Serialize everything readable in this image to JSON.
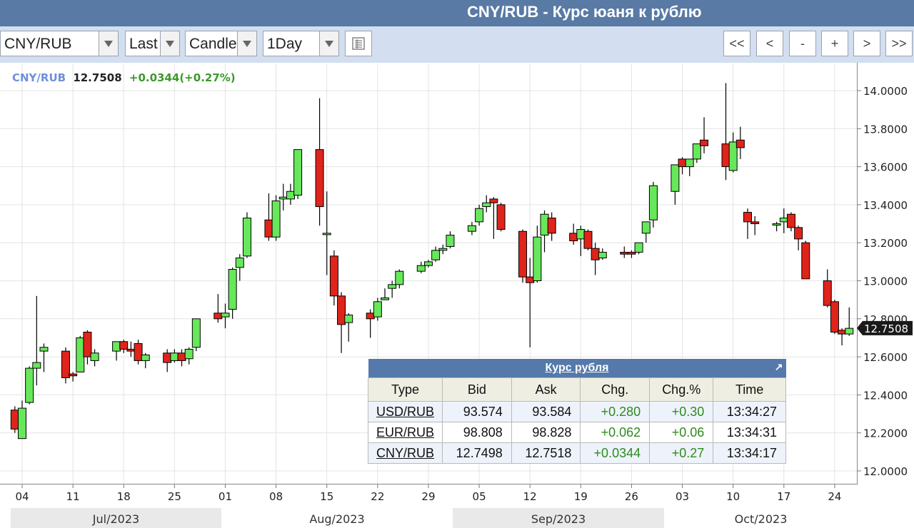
{
  "page_title": "CNY/RUB - Курс юаня к рублю",
  "toolbar": {
    "symbol": "CNY/RUB",
    "price_type": "Last",
    "chart_style": "Candle",
    "interval": "1Day",
    "nav": [
      "<<",
      "<",
      "-",
      "+",
      ">",
      ">>"
    ]
  },
  "quote": {
    "symbol": "CNY/RUB",
    "last": "12.7508",
    "change": "+0.0344(+0.27%)"
  },
  "chart_data": {
    "type": "candlestick",
    "title": "",
    "y_ticks": [
      "14.0000",
      "13.8000",
      "13.6000",
      "13.4000",
      "13.2000",
      "13.0000",
      "12.8000",
      "12.6000",
      "12.4000",
      "12.2000",
      "12.0000"
    ],
    "ylim": [
      11.96,
      14.15
    ],
    "x_ticks": [
      "04",
      "11",
      "18",
      "25",
      "01",
      "08",
      "15",
      "22",
      "29",
      "05",
      "12",
      "19",
      "26",
      "03",
      "10",
      "17",
      "24"
    ],
    "months": [
      "Jul/2023",
      "Aug/2023",
      "Sep/2023",
      "Oct/2023"
    ],
    "last_price_label": "12.7508",
    "colors": {
      "up": "#66e85a",
      "down": "#e0241b",
      "outline": "#000000"
    },
    "candles": [
      {
        "date": "2023-06-30",
        "o": 12.34,
        "h": 12.38,
        "l": 12.03,
        "c": 12.05
      },
      {
        "date": "2023-07-03",
        "o": 12.32,
        "h": 12.34,
        "l": 12.2,
        "c": 12.22
      },
      {
        "date": "2023-07-04",
        "o": 12.17,
        "h": 12.37,
        "l": 12.17,
        "c": 12.33
      },
      {
        "date": "2023-07-05",
        "o": 12.36,
        "h": 12.55,
        "l": 12.35,
        "c": 12.54
      },
      {
        "date": "2023-07-06",
        "o": 12.54,
        "h": 12.92,
        "l": 12.45,
        "c": 12.57
      },
      {
        "date": "2023-07-07",
        "o": 12.63,
        "h": 12.67,
        "l": 12.52,
        "c": 12.65
      },
      {
        "date": "2023-07-10",
        "o": 12.63,
        "h": 12.65,
        "l": 12.46,
        "c": 12.49
      },
      {
        "date": "2023-07-11",
        "o": 12.51,
        "h": 12.52,
        "l": 12.47,
        "c": 12.5
      },
      {
        "date": "2023-07-12",
        "o": 12.52,
        "h": 12.71,
        "l": 12.52,
        "c": 12.7
      },
      {
        "date": "2023-07-13",
        "o": 12.73,
        "h": 12.74,
        "l": 12.56,
        "c": 12.6
      },
      {
        "date": "2023-07-14",
        "o": 12.58,
        "h": 12.64,
        "l": 12.55,
        "c": 12.62
      },
      {
        "date": "2023-07-17",
        "o": 12.63,
        "h": 12.68,
        "l": 12.58,
        "c": 12.68
      },
      {
        "date": "2023-07-18",
        "o": 12.68,
        "h": 12.69,
        "l": 12.62,
        "c": 12.64
      },
      {
        "date": "2023-07-19",
        "o": 12.64,
        "h": 12.68,
        "l": 12.6,
        "c": 12.63
      },
      {
        "date": "2023-07-20",
        "o": 12.67,
        "h": 12.69,
        "l": 12.56,
        "c": 12.58
      },
      {
        "date": "2023-07-21",
        "o": 12.58,
        "h": 12.62,
        "l": 12.54,
        "c": 12.61
      },
      {
        "date": "2023-07-24",
        "o": 12.62,
        "h": 12.64,
        "l": 12.52,
        "c": 12.57
      },
      {
        "date": "2023-07-25",
        "o": 12.58,
        "h": 12.64,
        "l": 12.57,
        "c": 12.62
      },
      {
        "date": "2023-07-26",
        "o": 12.62,
        "h": 12.64,
        "l": 12.55,
        "c": 12.58
      },
      {
        "date": "2023-07-27",
        "o": 12.59,
        "h": 12.65,
        "l": 12.56,
        "c": 12.64
      },
      {
        "date": "2023-07-28",
        "o": 12.65,
        "h": 12.8,
        "l": 12.63,
        "c": 12.8
      },
      {
        "date": "2023-07-31",
        "o": 12.83,
        "h": 12.93,
        "l": 12.78,
        "c": 12.8
      },
      {
        "date": "2023-08-01",
        "o": 12.81,
        "h": 12.88,
        "l": 12.75,
        "c": 12.83
      },
      {
        "date": "2023-08-02",
        "o": 12.85,
        "h": 13.07,
        "l": 12.8,
        "c": 13.06
      },
      {
        "date": "2023-08-03",
        "o": 13.07,
        "h": 13.14,
        "l": 13.0,
        "c": 13.12
      },
      {
        "date": "2023-08-04",
        "o": 13.13,
        "h": 13.36,
        "l": 13.12,
        "c": 13.33
      },
      {
        "date": "2023-08-07",
        "o": 13.32,
        "h": 13.46,
        "l": 13.21,
        "c": 13.23
      },
      {
        "date": "2023-08-08",
        "o": 13.23,
        "h": 13.45,
        "l": 13.21,
        "c": 13.42
      },
      {
        "date": "2023-08-09",
        "o": 13.43,
        "h": 13.51,
        "l": 13.37,
        "c": 13.44
      },
      {
        "date": "2023-08-10",
        "o": 13.43,
        "h": 13.51,
        "l": 13.4,
        "c": 13.47
      },
      {
        "date": "2023-08-11",
        "o": 13.45,
        "h": 13.69,
        "l": 13.43,
        "c": 13.69
      },
      {
        "date": "2023-08-14",
        "o": 13.69,
        "h": 13.96,
        "l": 13.29,
        "c": 13.39
      },
      {
        "date": "2023-08-15",
        "o": 13.25,
        "h": 13.47,
        "l": 13.03,
        "c": 13.25
      },
      {
        "date": "2023-08-16",
        "o": 13.13,
        "h": 13.16,
        "l": 12.87,
        "c": 12.92
      },
      {
        "date": "2023-08-17",
        "o": 12.92,
        "h": 12.94,
        "l": 12.62,
        "c": 12.77
      },
      {
        "date": "2023-08-18",
        "o": 12.78,
        "h": 12.83,
        "l": 12.68,
        "c": 12.82
      },
      {
        "date": "2023-08-21",
        "o": 12.83,
        "h": 12.85,
        "l": 12.7,
        "c": 12.8
      },
      {
        "date": "2023-08-22",
        "o": 12.81,
        "h": 12.91,
        "l": 12.79,
        "c": 12.89
      },
      {
        "date": "2023-08-23",
        "o": 12.9,
        "h": 12.96,
        "l": 12.9,
        "c": 12.91
      },
      {
        "date": "2023-08-24",
        "o": 12.96,
        "h": 13.0,
        "l": 12.91,
        "c": 12.98
      },
      {
        "date": "2023-08-25",
        "o": 12.98,
        "h": 13.06,
        "l": 12.96,
        "c": 13.05
      },
      {
        "date": "2023-08-28",
        "o": 13.05,
        "h": 13.1,
        "l": 13.04,
        "c": 13.08
      },
      {
        "date": "2023-08-29",
        "o": 13.08,
        "h": 13.11,
        "l": 13.07,
        "c": 13.1
      },
      {
        "date": "2023-08-30",
        "o": 13.11,
        "h": 13.18,
        "l": 13.1,
        "c": 13.16
      },
      {
        "date": "2023-08-31",
        "o": 13.16,
        "h": 13.19,
        "l": 13.14,
        "c": 13.17
      },
      {
        "date": "2023-09-01",
        "o": 13.18,
        "h": 13.26,
        "l": 13.17,
        "c": 13.24
      },
      {
        "date": "2023-09-04",
        "o": 13.26,
        "h": 13.31,
        "l": 13.24,
        "c": 13.29
      },
      {
        "date": "2023-09-05",
        "o": 13.31,
        "h": 13.4,
        "l": 13.29,
        "c": 13.38
      },
      {
        "date": "2023-09-06",
        "o": 13.39,
        "h": 13.45,
        "l": 13.36,
        "c": 13.41
      },
      {
        "date": "2023-09-07",
        "o": 13.43,
        "h": 13.44,
        "l": 13.22,
        "c": 13.41
      },
      {
        "date": "2023-09-08",
        "o": 13.4,
        "h": 13.41,
        "l": 13.26,
        "c": 13.27
      },
      {
        "date": "2023-09-11",
        "o": 13.26,
        "h": 13.27,
        "l": 12.99,
        "c": 13.02
      },
      {
        "date": "2023-09-12",
        "o": 13.02,
        "h": 13.12,
        "l": 12.65,
        "c": 12.99
      },
      {
        "date": "2023-09-13",
        "o": 13.0,
        "h": 13.29,
        "l": 12.99,
        "c": 13.23
      },
      {
        "date": "2023-09-14",
        "o": 13.24,
        "h": 13.37,
        "l": 13.15,
        "c": 13.35
      },
      {
        "date": "2023-09-15",
        "o": 13.33,
        "h": 13.36,
        "l": 13.21,
        "c": 13.25
      },
      {
        "date": "2023-09-18",
        "o": 13.25,
        "h": 13.3,
        "l": 13.19,
        "c": 13.21
      },
      {
        "date": "2023-09-19",
        "o": 13.22,
        "h": 13.29,
        "l": 13.13,
        "c": 13.27
      },
      {
        "date": "2023-09-20",
        "o": 13.26,
        "h": 13.27,
        "l": 13.16,
        "c": 13.17
      },
      {
        "date": "2023-09-21",
        "o": 13.17,
        "h": 13.2,
        "l": 13.03,
        "c": 13.11
      },
      {
        "date": "2023-09-22",
        "o": 13.12,
        "h": 13.17,
        "l": 13.11,
        "c": 13.15
      },
      {
        "date": "2023-09-25",
        "o": 13.15,
        "h": 13.18,
        "l": 13.12,
        "c": 13.14
      },
      {
        "date": "2023-09-26",
        "o": 13.15,
        "h": 13.16,
        "l": 13.12,
        "c": 13.14
      },
      {
        "date": "2023-09-27",
        "o": 13.15,
        "h": 13.2,
        "l": 13.14,
        "c": 13.2
      },
      {
        "date": "2023-09-28",
        "o": 13.25,
        "h": 13.31,
        "l": 13.2,
        "c": 13.31
      },
      {
        "date": "2023-09-29",
        "o": 13.32,
        "h": 13.52,
        "l": 13.28,
        "c": 13.5
      },
      {
        "date": "2023-10-02",
        "o": 13.47,
        "h": 13.61,
        "l": 13.4,
        "c": 13.61
      },
      {
        "date": "2023-10-03",
        "o": 13.64,
        "h": 13.65,
        "l": 13.56,
        "c": 13.6
      },
      {
        "date": "2023-10-04",
        "o": 13.6,
        "h": 13.64,
        "l": 13.55,
        "c": 13.64
      },
      {
        "date": "2023-10-05",
        "o": 13.64,
        "h": 13.72,
        "l": 13.62,
        "c": 13.72
      },
      {
        "date": "2023-10-06",
        "o": 13.74,
        "h": 13.86,
        "l": 13.67,
        "c": 13.71
      },
      {
        "date": "2023-10-09",
        "o": 13.72,
        "h": 14.04,
        "l": 13.53,
        "c": 13.6
      },
      {
        "date": "2023-10-10",
        "o": 13.58,
        "h": 13.78,
        "l": 13.57,
        "c": 13.73
      },
      {
        "date": "2023-10-11",
        "o": 13.74,
        "h": 13.81,
        "l": 13.64,
        "c": 13.7
      },
      {
        "date": "2023-10-12",
        "o": 13.36,
        "h": 13.38,
        "l": 13.22,
        "c": 13.31
      },
      {
        "date": "2023-10-13",
        "o": 13.31,
        "h": 13.34,
        "l": 13.24,
        "c": 13.3
      },
      {
        "date": "2023-10-16",
        "o": 13.3,
        "h": 13.31,
        "l": 13.26,
        "c": 13.3
      },
      {
        "date": "2023-10-17",
        "o": 13.31,
        "h": 13.38,
        "l": 13.25,
        "c": 13.33
      },
      {
        "date": "2023-10-18",
        "o": 13.35,
        "h": 13.36,
        "l": 13.26,
        "c": 13.28
      },
      {
        "date": "2023-10-19",
        "o": 13.28,
        "h": 13.29,
        "l": 13.16,
        "c": 13.22
      },
      {
        "date": "2023-10-20",
        "o": 13.2,
        "h": 13.21,
        "l": 13.01,
        "c": 13.01
      },
      {
        "date": "2023-10-23",
        "o": 13.0,
        "h": 13.06,
        "l": 12.86,
        "c": 12.87
      },
      {
        "date": "2023-10-24",
        "o": 12.89,
        "h": 12.9,
        "l": 12.72,
        "c": 12.73
      },
      {
        "date": "2023-10-25",
        "o": 12.74,
        "h": 12.75,
        "l": 12.66,
        "c": 12.72
      },
      {
        "date": "2023-10-26",
        "o": 12.72,
        "h": 12.86,
        "l": 12.71,
        "c": 12.75
      }
    ]
  },
  "quote_table": {
    "caption": "Курс рубля",
    "headers": [
      "Type",
      "Bid",
      "Ask",
      "Chg.",
      "Chg.%",
      "Time"
    ],
    "rows": [
      [
        "USD/RUB",
        "93.574",
        "93.584",
        "+0.280",
        "+0.30",
        "13:34:27"
      ],
      [
        "EUR/RUB",
        "98.808",
        "98.828",
        "+0.062",
        "+0.06",
        "13:34:31"
      ],
      [
        "CNY/RUB",
        "12.7498",
        "12.7518",
        "+0.0344",
        "+0.27",
        "13:34:17"
      ]
    ]
  }
}
